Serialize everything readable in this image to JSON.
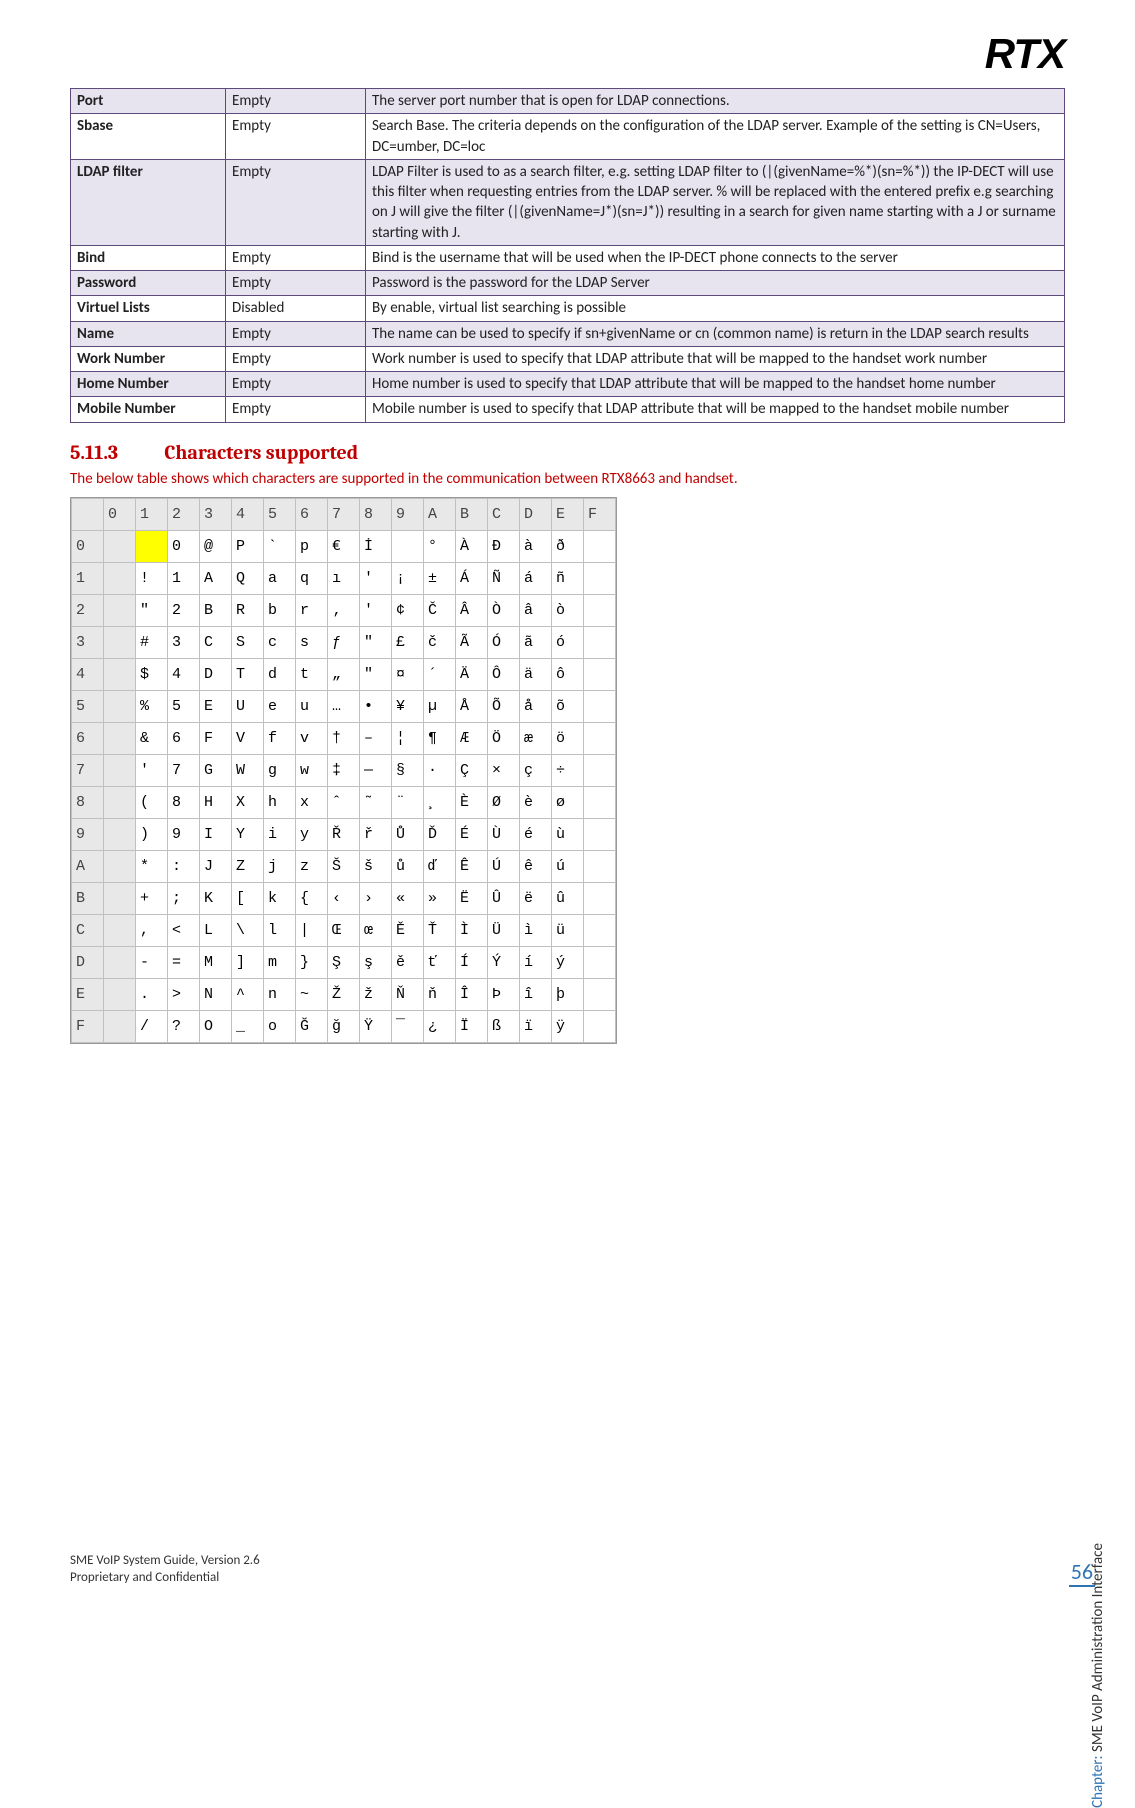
{
  "logo": "RTX",
  "params": [
    {
      "shaded": true,
      "name": "Port",
      "default": "Empty",
      "desc": "The server port number that is open for LDAP connections."
    },
    {
      "shaded": false,
      "name": "Sbase",
      "default": "Empty",
      "desc": "Search Base. The criteria depends on the configuration of the LDAP server. Example of the setting is CN=Users, DC=umber, DC=loc"
    },
    {
      "shaded": true,
      "name": "LDAP filter",
      "default": "Empty",
      "desc": "LDAP Filter is used to as a search filter, e.g. setting LDAP filter to (|(givenName=%*)(sn=%*)) the IP-DECT will use this filter when requesting entries from the LDAP server. % will be replaced with the entered prefix e.g searching on J will give the filter (|(givenName=J*)(sn=J*)) resulting in a search for given name starting with a J or surname starting with J."
    },
    {
      "shaded": false,
      "name": "Bind",
      "default": "Empty",
      "desc": "Bind is the username that will be used when the IP-DECT phone connects to the server"
    },
    {
      "shaded": true,
      "name": "Password",
      "default": "Empty",
      "desc": "Password is the password for the LDAP Server"
    },
    {
      "shaded": false,
      "name": "Virtuel Lists",
      "default": "Disabled",
      "desc": "By enable, virtual list searching is possible"
    },
    {
      "shaded": true,
      "name": "Name",
      "default": "Empty",
      "desc": "The name can be used to specify if sn+givenName or cn (common name) is return in the LDAP search results"
    },
    {
      "shaded": false,
      "name": "Work Number",
      "default": "Empty",
      "desc": "Work number is used to specify that LDAP attribute that will be mapped to the handset work number"
    },
    {
      "shaded": true,
      "name": "Home Number",
      "default": "Empty",
      "desc": "Home number is used to specify that LDAP attribute that will be mapped to the handset home number"
    },
    {
      "shaded": false,
      "name": "Mobile Number",
      "default": "Empty",
      "desc": "Mobile number is used to specify that LDAP attribute that will be mapped to the handset mobile number"
    }
  ],
  "section": {
    "num": "5.11.3",
    "title": "Characters supported"
  },
  "intro": "The below table shows which characters are supported in the communication between RTX8663 and handset.",
  "chart_data": {
    "type": "table",
    "title": "Character map (high nibble columns 0–F, low nibble rows 0–F)",
    "col_headers": [
      "0",
      "1",
      "2",
      "3",
      "4",
      "5",
      "6",
      "7",
      "8",
      "9",
      "A",
      "B",
      "C",
      "D",
      "E",
      "F"
    ],
    "row_headers": [
      "0",
      "1",
      "2",
      "3",
      "4",
      "5",
      "6",
      "7",
      "8",
      "9",
      "A",
      "B",
      "C",
      "D",
      "E",
      "F"
    ],
    "highlight": {
      "row": 0,
      "col": 1
    },
    "shaded_cols": [
      0
    ],
    "rows": [
      [
        "",
        "",
        "0",
        "@",
        "P",
        "`",
        "p",
        "€",
        "İ",
        "",
        "°",
        "À",
        "Đ",
        "à",
        "ð"
      ],
      [
        "",
        "!",
        "1",
        "A",
        "Q",
        "a",
        "q",
        "ı",
        "'",
        "¡",
        "±",
        "Á",
        "Ñ",
        "á",
        "ñ"
      ],
      [
        "",
        "\"",
        "2",
        "B",
        "R",
        "b",
        "r",
        "‚",
        "'",
        "¢",
        "Č",
        "Â",
        "Ò",
        "â",
        "ò"
      ],
      [
        "",
        "#",
        "3",
        "C",
        "S",
        "c",
        "s",
        "ƒ",
        "\"",
        "£",
        "č",
        "Ã",
        "Ó",
        "ã",
        "ó"
      ],
      [
        "",
        "$",
        "4",
        "D",
        "T",
        "d",
        "t",
        "„",
        "\"",
        "¤",
        "´",
        "Ä",
        "Ô",
        "ä",
        "ô"
      ],
      [
        "",
        "%",
        "5",
        "E",
        "U",
        "e",
        "u",
        "…",
        "•",
        "¥",
        "µ",
        "Å",
        "Õ",
        "å",
        "õ"
      ],
      [
        "",
        "&",
        "6",
        "F",
        "V",
        "f",
        "v",
        "†",
        "–",
        "¦",
        "¶",
        "Æ",
        "Ö",
        "æ",
        "ö"
      ],
      [
        "",
        "'",
        "7",
        "G",
        "W",
        "g",
        "w",
        "‡",
        "—",
        "§",
        "·",
        "Ç",
        "×",
        "ç",
        "÷"
      ],
      [
        "",
        "(",
        "8",
        "H",
        "X",
        "h",
        "x",
        "ˆ",
        "˜",
        "¨",
        "¸",
        "È",
        "Ø",
        "è",
        "ø"
      ],
      [
        "",
        ")",
        "9",
        "I",
        "Y",
        "i",
        "y",
        "Ř",
        "ř",
        "Ů",
        "Ď",
        "É",
        "Ù",
        "é",
        "ù"
      ],
      [
        "",
        "*",
        ":",
        "J",
        "Z",
        "j",
        "z",
        "Š",
        "š",
        "ů",
        "ď",
        "Ê",
        "Ú",
        "ê",
        "ú"
      ],
      [
        "",
        "+",
        ";",
        "K",
        "[",
        "k",
        "{",
        "‹",
        "›",
        "«",
        "»",
        "Ë",
        "Û",
        "ë",
        "û"
      ],
      [
        "",
        ",",
        "<",
        "L",
        "\\",
        "l",
        "|",
        "Œ",
        "œ",
        "Ě",
        "Ť",
        "Ì",
        "Ü",
        "ì",
        "ü"
      ],
      [
        "",
        "-",
        "=",
        "M",
        "]",
        "m",
        "}",
        "Ş",
        "ş",
        "ě",
        "ť",
        "Í",
        "Ý",
        "í",
        "ý"
      ],
      [
        "",
        ".",
        ">",
        "N",
        "^",
        "n",
        "~",
        "Ž",
        "ž",
        "Ň",
        "ň",
        "Î",
        "Þ",
        "î",
        "þ"
      ],
      [
        "",
        "/",
        "?",
        "O",
        "_",
        "o",
        "Ğ",
        "ğ",
        "Ÿ",
        "¯",
        "¿",
        "Ï",
        "ß",
        "ï",
        "ÿ"
      ]
    ]
  },
  "side": {
    "chapter_label": "Chapter:",
    "chapter_text": "SME VoIP Administration Interface"
  },
  "page_number": "56",
  "footer": {
    "line1": "SME VoIP System Guide, Version 2.6",
    "line2": "Proprietary and Confidential"
  }
}
